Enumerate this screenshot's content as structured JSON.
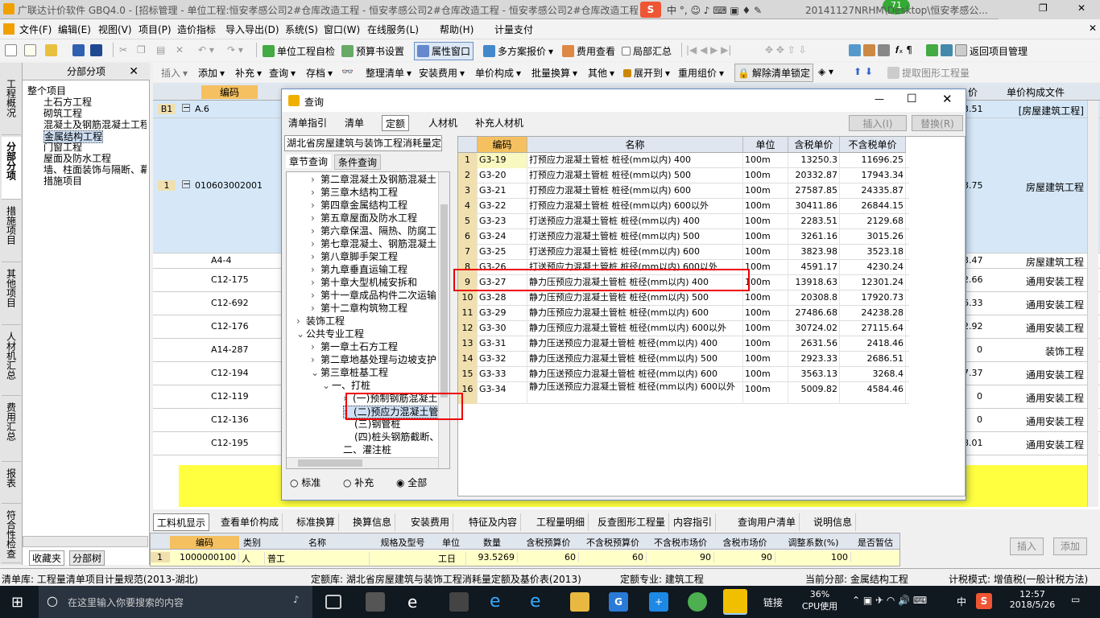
{
  "window": {
    "title": "广联达计价软件 GBQ4.0 - [招标管理 - 单位工程:恒安孝感公司2#仓库改造工程 - 恒安孝感公司2#仓库改造工程 - 恒安孝感公司2#仓库改造工程-土...",
    "title_right": "20141127NRHM\\Desktop\\恒安孝感公...",
    "badge": "71"
  },
  "menu": [
    "文件(F)",
    "编辑(E)",
    "视图(V)",
    "项目(P)",
    "造价指标",
    "导入导出(D)",
    "系统(S)",
    "窗口(W)",
    "在线服务(L)",
    "帮助(H)",
    "计量支付"
  ],
  "toolbar1": {
    "check": "单位工程自检",
    "budget": "预算书设置",
    "attr": "属性窗口",
    "multi": "多方案报价",
    "fee": "费用查看",
    "local": "局部汇总",
    "back": "返回项目管理"
  },
  "toolbar2": [
    "插入",
    "添加",
    "补充",
    "查询",
    "存档",
    "整理清单",
    "安装费用",
    "单价构成",
    "批量换算",
    "其他",
    "展开到",
    "重用组价",
    "解除清单锁定",
    "提取图形工程量"
  ],
  "left_tabs": [
    "工程概况",
    "分部分项",
    "措施项目",
    "其他项目",
    "人材机汇总",
    "费用汇总",
    "报表",
    "符合性检查"
  ],
  "tree_panel": {
    "header": "分部分项",
    "items": [
      "整个项目",
      "土石方工程",
      "砌筑工程",
      "混凝土及钢筋混凝土工程",
      "金属结构工程",
      "门窗工程",
      "屋面及防水工程",
      "墙、柱面装饰与隔断、幕",
      "措施项目"
    ],
    "tab_fav": "收藏夹",
    "tab_tree": "分部树"
  },
  "main_grid": {
    "col_code": "编码",
    "col_price": "价",
    "col_file": "单价构成文件",
    "rows": [
      {
        "no": "B1",
        "code": "A.6",
        "price": "3.51",
        "file": "[房屋建筑工程]"
      },
      {
        "no": "1",
        "code": "010603002001",
        "price": "3.75",
        "file": "房屋建筑工程"
      },
      {
        "no": "",
        "code": "A4-4",
        "price": "3.47",
        "file": "房屋建筑工程"
      },
      {
        "no": "",
        "code": "C12-175",
        "price": "2.66",
        "file": "通用安装工程"
      },
      {
        "no": "",
        "code": "C12-692",
        "price": "6.33",
        "file": "通用安装工程"
      },
      {
        "no": "",
        "code": "C12-176",
        "price": "2.92",
        "file": "通用安装工程"
      },
      {
        "no": "",
        "code": "A14-287",
        "price": "0",
        "file": "装饰工程"
      },
      {
        "no": "",
        "code": "C12-194",
        "price": "7.37",
        "file": "通用安装工程"
      },
      {
        "no": "",
        "code": "C12-119",
        "price": "0",
        "file": "通用安装工程"
      },
      {
        "no": "",
        "code": "C12-136",
        "price": "0",
        "file": "通用安装工程"
      },
      {
        "no": "",
        "code": "C12-195",
        "price": "8.01",
        "file": "通用安装工程"
      }
    ]
  },
  "dialog": {
    "title": "查询",
    "tabs": [
      "清单指引",
      "清单",
      "定额",
      "人材机",
      "补充人材机"
    ],
    "insert": "插入(I)",
    "replace": "替换(R)",
    "library": "湖北省房屋建筑与装饰工程消耗量定",
    "subtabs": [
      "章节查询",
      "条件查询"
    ],
    "tree": [
      "第二章混凝土及钢筋混凝土",
      "第三章木结构工程",
      "第四章金属结构工程",
      "第五章屋面及防水工程",
      "第六章保温、隔热、防腐工",
      "第七章混凝土、钢筋混凝土",
      "第八章脚手架工程",
      "第九章垂直运输工程",
      "第十章大型机械安拆和",
      "第十一章成品构件二次运输",
      "第十二章构筑物工程",
      "装饰工程",
      "公共专业工程",
      "第一章土石方工程",
      "第二章地基处理与边坡支护",
      "第三章桩基工程",
      "一、打桩",
      "(一)预制钢筋混凝土",
      "(二)预应力混凝土管",
      "(三)钢管桩",
      "(四)桩头钢筋截断、",
      "二、灌注桩"
    ],
    "radios": [
      "标准",
      "补充",
      "全部"
    ],
    "grid_headers": [
      "编码",
      "名称",
      "单位",
      "含税单价",
      "不含税单价"
    ],
    "rows": [
      [
        "1",
        "G3-19",
        "打预应力混凝土管桩 桩径(mm以内) 400",
        "100m",
        "13250.3",
        "11696.25"
      ],
      [
        "2",
        "G3-20",
        "打预应力混凝土管桩 桩径(mm以内) 500",
        "100m",
        "20332.87",
        "17943.34"
      ],
      [
        "3",
        "G3-21",
        "打预应力混凝土管桩 桩径(mm以内) 600",
        "100m",
        "27587.85",
        "24335.87"
      ],
      [
        "4",
        "G3-22",
        "打预应力混凝土管桩 桩径(mm以内) 600以外",
        "100m",
        "30411.86",
        "26844.15"
      ],
      [
        "5",
        "G3-23",
        "打送预应力混凝土管桩 桩径(mm以内) 400",
        "100m",
        "2283.51",
        "2129.68"
      ],
      [
        "6",
        "G3-24",
        "打送预应力混凝土管桩 桩径(mm以内) 500",
        "100m",
        "3261.16",
        "3015.26"
      ],
      [
        "7",
        "G3-25",
        "打送预应力混凝土管桩 桩径(mm以内) 600",
        "100m",
        "3823.98",
        "3523.18"
      ],
      [
        "8",
        "G3-26",
        "打送预应力混凝土管桩 桩径(mm以内) 600以外",
        "100m",
        "4591.17",
        "4230.24"
      ],
      [
        "9",
        "G3-27",
        "静力压预应力混凝土管桩 桩径(mm以内) 400",
        "100m",
        "13918.63",
        "12301.24"
      ],
      [
        "10",
        "G3-28",
        "静力压预应力混凝土管桩 桩径(mm以内) 500",
        "100m",
        "20308.8",
        "17920.73"
      ],
      [
        "11",
        "G3-29",
        "静力压预应力混凝土管桩 桩径(mm以内) 600",
        "100m",
        "27486.68",
        "24238.28"
      ],
      [
        "12",
        "G3-30",
        "静力压预应力混凝土管桩 桩径(mm以内) 600以外",
        "100m",
        "30724.02",
        "27115.64"
      ],
      [
        "13",
        "G3-31",
        "静力压送预应力混凝土管桩 桩径(mm以内) 400",
        "100m",
        "2631.56",
        "2418.46"
      ],
      [
        "14",
        "G3-32",
        "静力压送预应力混凝土管桩 桩径(mm以内) 500",
        "100m",
        "2923.33",
        "2686.51"
      ],
      [
        "15",
        "G3-33",
        "静力压送预应力混凝土管桩 桩径(mm以内) 600",
        "100m",
        "3563.13",
        "3268.4"
      ],
      [
        "16",
        "G3-34",
        "静力压送预应力混凝土管桩 桩径(mm以内) 600以外",
        "100m",
        "5009.82",
        "4584.46"
      ]
    ]
  },
  "bottom_tabs": [
    "工料机显示",
    "查看单价构成",
    "标准换算",
    "换算信息",
    "安装费用",
    "特征及内容",
    "工程量明细",
    "反查图形工程量",
    "内容指引",
    "查询用户清单",
    "说明信息"
  ],
  "bottom_grid": {
    "headers": [
      "编码",
      "类别",
      "名称",
      "规格及型号",
      "单位",
      "数量",
      "含税预算价",
      "不含税预算价",
      "不含税市场价",
      "含税市场价",
      "调整系数(%)",
      "是否暂估"
    ],
    "row": [
      "1",
      "1000000100",
      "人",
      "普工",
      "",
      "工日",
      "93.5269",
      "60",
      "60",
      "90",
      "90",
      "100",
      ""
    ]
  },
  "bottom_buttons": {
    "insert": "插入",
    "add": "添加"
  },
  "status": {
    "s1": "清单库: 工程量清单项目计量规范(2013-湖北)",
    "s2": "定额库: 湖北省房屋建筑与装饰工程消耗量定额及基价表(2013)",
    "s3": "定额专业: 建筑工程",
    "s4": "当前分部: 金属结构工程",
    "s5": "计税模式: 增值税(一般计税方法)"
  },
  "taskbar": {
    "search": "在这里输入你要搜索的内容",
    "link": "链接",
    "cpu": "36%",
    "cpu_label": "CPU使用",
    "ime": "中",
    "time": "12:57",
    "date": "2018/5/26"
  }
}
